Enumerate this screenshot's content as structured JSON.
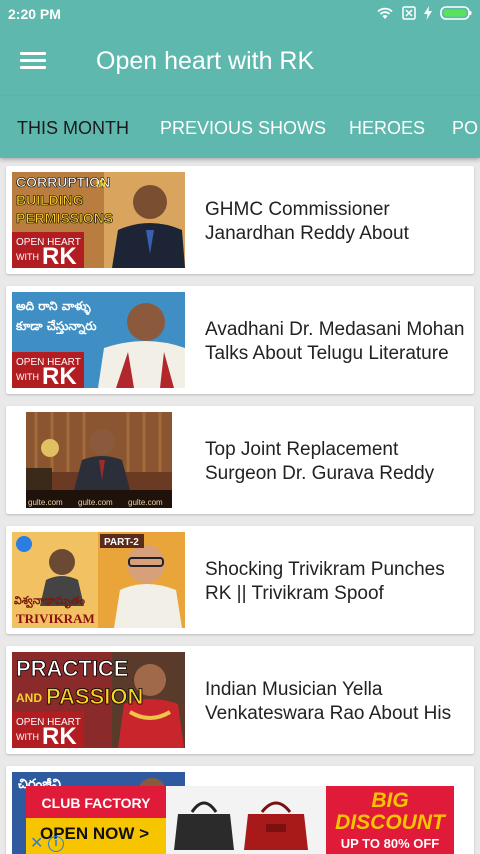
{
  "status_bar": {
    "time": "2:20 PM"
  },
  "app_bar": {
    "title": "Open heart with RK"
  },
  "tabs": [
    {
      "label": "THIS MONTH"
    },
    {
      "label": "PREVIOUS SHOWS"
    },
    {
      "label": "HEROES"
    },
    {
      "label": "PO"
    }
  ],
  "videos": [
    {
      "title_line1": "GHMC Commissioner",
      "title_line2": "Janardhan Reddy About",
      "thumb_text1": "CORRUPTION",
      "thumb_text2": "IN",
      "thumb_text3": "BUILDING",
      "thumb_text4": "PERMISSIONS",
      "thumb_brand1": "OPEN HEART",
      "thumb_brand2": "WITH",
      "thumb_brand3": "RK"
    },
    {
      "title_line1": "Avadhani Dr. Medasani Mohan",
      "title_line2": "Talks About Telugu Literature",
      "thumb_text1": "అది రాని వాళ్ళు",
      "thumb_text2": "కూడా చేస్తున్నారు",
      "thumb_brand1": "OPEN HEART",
      "thumb_brand2": "WITH",
      "thumb_brand3": "RK"
    },
    {
      "title_line1": "Top Joint Replacement",
      "title_line2": "Surgeon Dr. Gurava Reddy",
      "thumb_text1": "gulte.com",
      "thumb_text2": "gulte.com",
      "thumb_text3": "gulte.com"
    },
    {
      "title_line1": "Shocking Trivikram Punches",
      "title_line2": "RK || Trivikram Spoof",
      "thumb_text1": "PART-2",
      "thumb_text2": "TRIVIKRAM",
      "thumb_text3": "విశ్వనాథామృతం"
    },
    {
      "title_line1": "Indian Musician Yella",
      "title_line2": "Venkateswara Rao About His",
      "thumb_text1": "PRACTICE",
      "thumb_text2": "AND",
      "thumb_text3": "PASSION",
      "thumb_brand1": "OPEN HEART",
      "thumb_brand2": "WITH",
      "thumb_brand3": "RK"
    },
    {
      "thumb_text1": "చిరంజీవి"
    }
  ],
  "ad": {
    "brand": "CLUB FACTORY",
    "cta": "OPEN NOW >",
    "headline": "BIG DISCOUNT",
    "offer": "UP TO 80% OFF",
    "close_symbol": "✕",
    "info_symbol": "i"
  },
  "colors": {
    "primary": "#5fb8ae",
    "active_tab_text": "#1a1a1a",
    "inactive_tab_text": "#ffffff",
    "ad_red": "#e01b3a",
    "ad_yellow": "#f7c400"
  },
  "icons": [
    "menu-icon",
    "wifi-icon",
    "sim-icon",
    "charging-icon",
    "battery-icon",
    "ad-close-icon",
    "ad-info-icon"
  ]
}
